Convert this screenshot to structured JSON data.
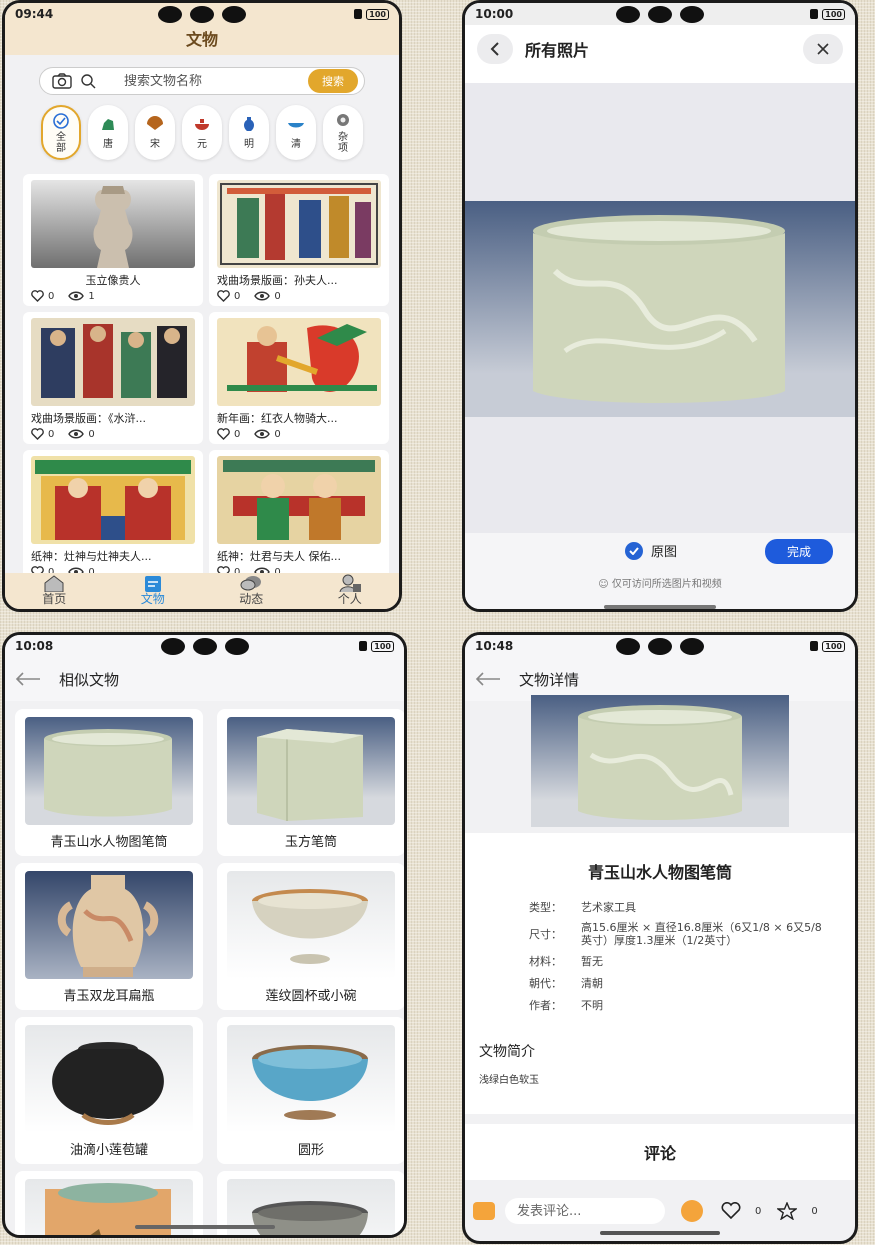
{
  "p1": {
    "time": "09:44",
    "battery": "100",
    "title": "文物",
    "search_placeholder": "搜索文物名称",
    "search_btn": "搜索",
    "categories": [
      "全部",
      "唐",
      "宋",
      "元",
      "明",
      "清",
      "杂项"
    ],
    "items": [
      {
        "title": "玉立像贵人",
        "likes": "0",
        "views": "1"
      },
      {
        "title": "戏曲场景版画：孙夫人...",
        "likes": "0",
        "views": "0"
      },
      {
        "title": "戏曲场景版画：《水浒...",
        "likes": "0",
        "views": "0"
      },
      {
        "title": "新年画：红衣人物骑大...",
        "likes": "0",
        "views": "0"
      },
      {
        "title": "纸神：灶神与灶神夫人...",
        "likes": "0",
        "views": "0"
      },
      {
        "title": "纸神：灶君与夫人 保佑...",
        "likes": "0",
        "views": "0"
      }
    ],
    "tabs": [
      "首页",
      "文物",
      "动态",
      "个人"
    ]
  },
  "p2": {
    "time": "10:00",
    "battery": "100",
    "title": "所有照片",
    "original": "原图",
    "done": "完成",
    "note": "仅可访问所选图片和视频"
  },
  "p3": {
    "time": "10:08",
    "battery": "100",
    "title": "相似文物",
    "items": [
      "青玉山水人物图笔筒",
      "玉方笔筒",
      "青玉双龙耳扁瓶",
      "莲纹圆杯或小碗",
      "油滴小莲苞罐",
      "圆形"
    ]
  },
  "p4": {
    "time": "10:48",
    "battery": "100",
    "title": "文物详情",
    "name": "青玉山水人物图笔筒",
    "props": [
      {
        "k": "类型：",
        "v": "艺术家工具"
      },
      {
        "k": "尺寸：",
        "v": "高15.6厘米 × 直径16.8厘米（6又1/8 × 6又5/8英寸）厚度1.3厘米（1/2英寸）"
      },
      {
        "k": "材料：",
        "v": "暂无"
      },
      {
        "k": "朝代：",
        "v": "清朝"
      },
      {
        "k": "作者：",
        "v": "不明"
      }
    ],
    "intro_title": "文物简介",
    "intro": "浅绿白色软玉",
    "comments_title": "评论",
    "comment_placeholder": "发表评论...",
    "likes": "0",
    "stars": "0"
  }
}
